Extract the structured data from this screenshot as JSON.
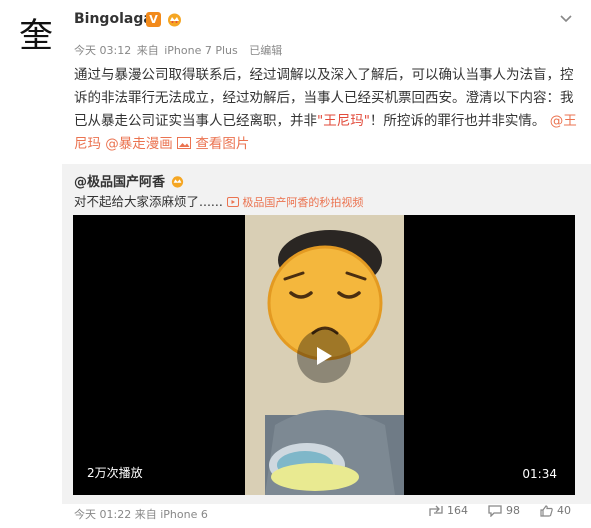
{
  "post": {
    "avatar_glyph": "奎",
    "username": "Bingolaga",
    "verified_badge": "V",
    "meta": {
      "time": "今天 03:12",
      "source_prefix": "来自",
      "device": "iPhone 7 Plus",
      "edited": "已编辑"
    },
    "text": {
      "part1": "通过与暴漫公司取得联系后，经过调解以及深入了解后，可以确认当事人为法盲，控诉的非法罪行无法成立，经过劝解后，当事人已经买机票回西安。澄清以下内容：我已从暴走公司证实当事人已经离职，并非",
      "quoted_name": "\"王尼玛\"",
      "part2": "！所控诉的罪行也并非实情。",
      "mention1": "@王尼玛",
      "mention2": "@暴走漫画",
      "view_pic": "查看图片"
    }
  },
  "repost": {
    "author": "@极品国产阿香",
    "text": "对不起给大家添麻烦了......",
    "video_link": "极品国产阿香的秒拍视频",
    "video": {
      "views": "2万次播放",
      "duration": "01:34"
    },
    "meta": {
      "time": "今天 01:22",
      "source_prefix": "来自",
      "device": "iPhone 6"
    },
    "actions": {
      "reposts": "164",
      "comments": "98",
      "likes": "40"
    }
  },
  "colors": {
    "accent": "#eb7350",
    "verified": "#f28a1b",
    "repost_bg": "#f2f2f2"
  }
}
